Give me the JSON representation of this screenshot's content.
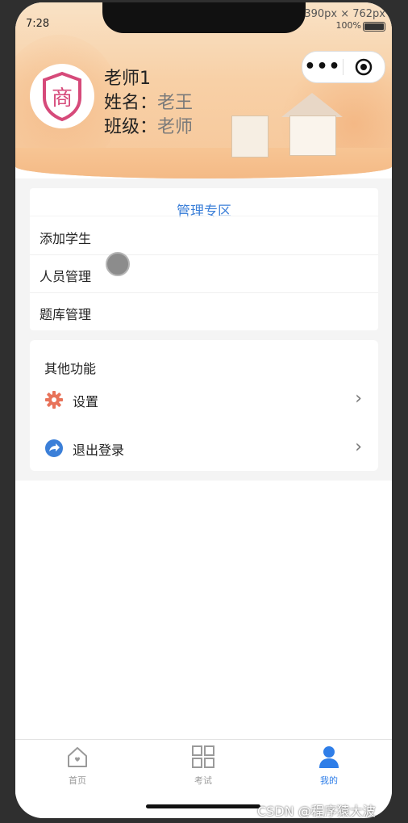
{
  "status": {
    "time": "7:28",
    "resolution": "390px × 762px",
    "battery_text": "100%"
  },
  "profile": {
    "name": "老师1",
    "fields": [
      {
        "label": "姓名：",
        "value": "老王"
      },
      {
        "label": "班级：",
        "value": "老师"
      }
    ],
    "avatar_char": "商"
  },
  "capsule": {
    "more": "•••"
  },
  "admin_section": {
    "title": "管理专区",
    "items": [
      "添加学生",
      "人员管理",
      "题库管理"
    ]
  },
  "other_section": {
    "title": "其他功能",
    "items": [
      {
        "label": "设置",
        "icon": "gear-icon",
        "color": "#e8735a"
      },
      {
        "label": "退出登录",
        "icon": "share-forward-icon",
        "color": "#3b7fd8"
      }
    ],
    "chevron": "›"
  },
  "tabbar": {
    "tabs": [
      {
        "label": "首页",
        "icon": "home-icon"
      },
      {
        "label": "考试",
        "icon": "grid-icon"
      },
      {
        "label": "我的",
        "icon": "user-icon",
        "active": true
      }
    ],
    "active_color": "#2f7ee8"
  },
  "watermark": "CSDN @程序猿大波"
}
